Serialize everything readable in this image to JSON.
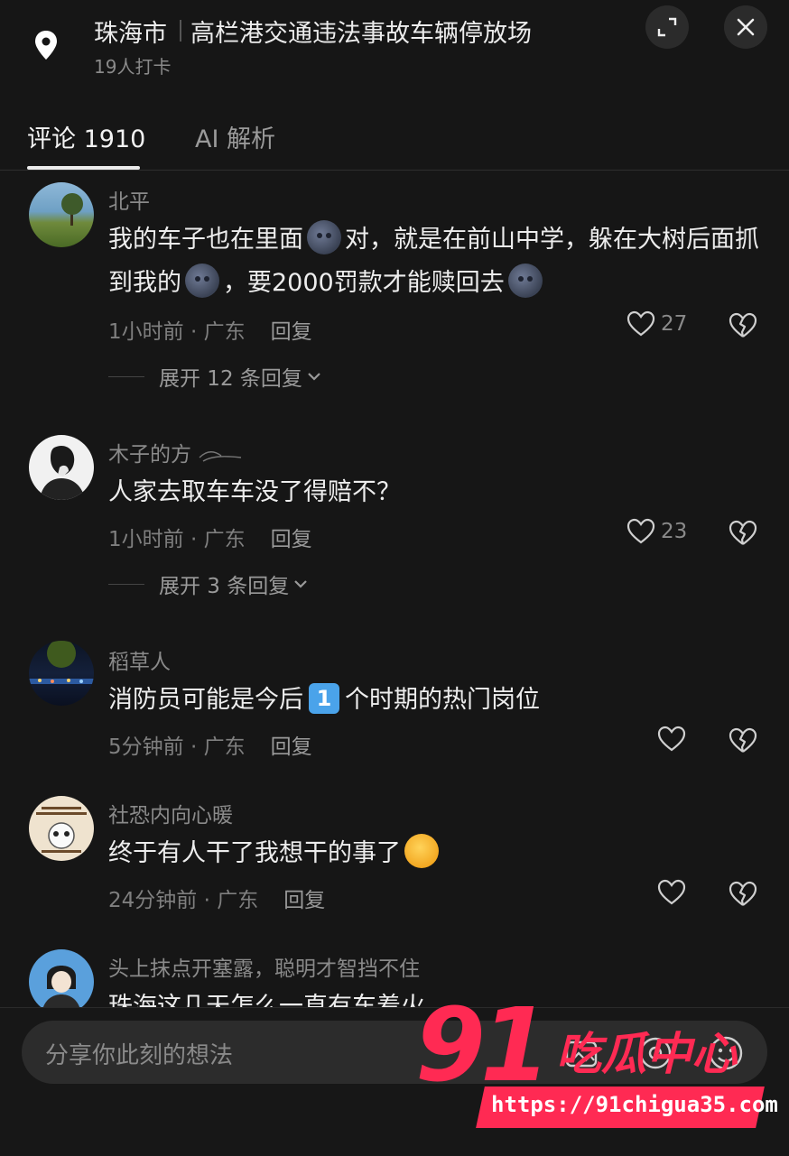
{
  "header": {
    "city": "珠海市",
    "place": "高栏港交通违法事故车辆停放场",
    "checkins": "19人打卡"
  },
  "tabs": [
    {
      "label": "评论 1910",
      "active": true
    },
    {
      "label": "AI 解析",
      "active": false
    }
  ],
  "comments": [
    {
      "user": "北平",
      "text_parts": [
        "我的车子也在里面",
        "对，就是在前山中学，躲在大树后面抓到我的",
        "，要2000罚款才能赎回去"
      ],
      "time": "1小时前 · 广东",
      "reply": "回复",
      "likes": "27",
      "expand": "展开 12 条回复"
    },
    {
      "user": "木子的方",
      "text": "人家去取车车没了得赔不？",
      "time": "1小时前 · 广东",
      "reply": "回复",
      "likes": "23",
      "expand": "展开 3 条回复"
    },
    {
      "user": "稻草人",
      "text_parts": [
        "消防员可能是今后",
        "个时期的热门岗位"
      ],
      "badge": "1",
      "time": "5分钟前 · 广东",
      "reply": "回复"
    },
    {
      "user": "社恐内向心暖",
      "text": "终于有人干了我想干的事了",
      "time": "24分钟前 · 广东",
      "reply": "回复"
    },
    {
      "user": "头上抹点开塞露，聪明才智挡不住",
      "text": "珠海这几天怎么一直有车着火"
    }
  ],
  "bottom": {
    "placeholder": "分享你此刻的想法"
  },
  "watermark": {
    "number": "91",
    "text": "吃瓜中心",
    "url": "https://91chigua35.com"
  },
  "colors": {
    "background": "#161616",
    "accent": "#ff2a53"
  }
}
